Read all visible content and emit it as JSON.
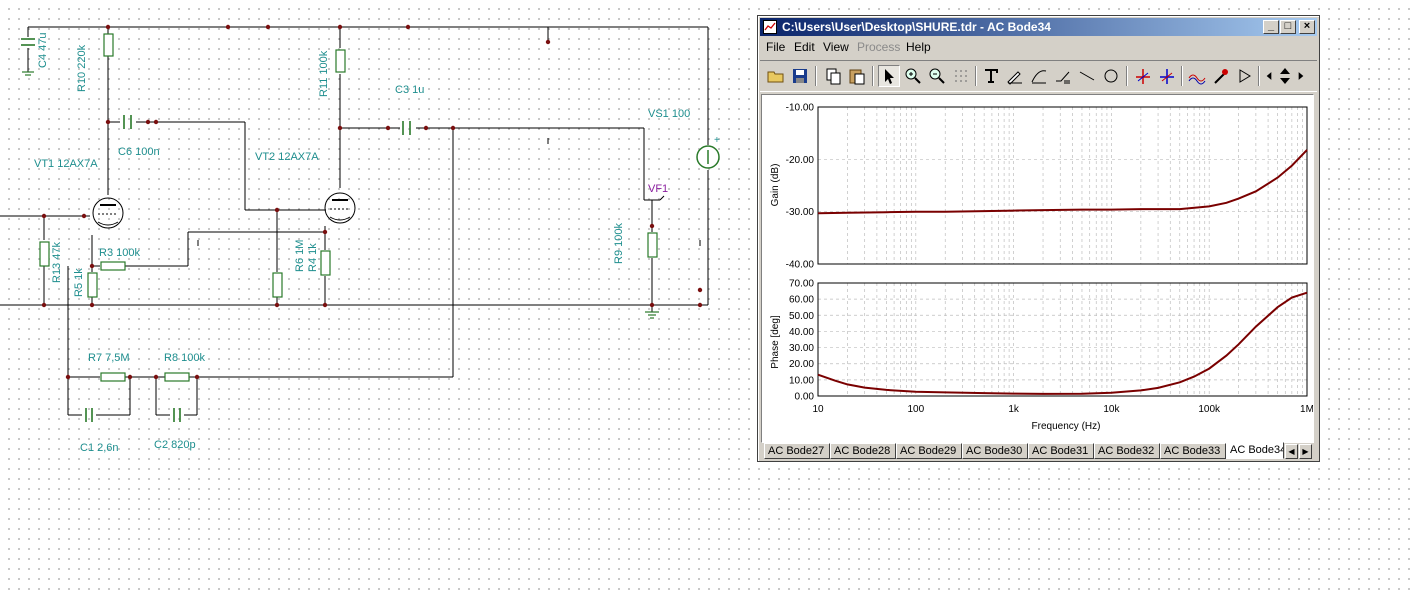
{
  "schematic": {
    "labels": {
      "c4": "C4 47u",
      "r10": "R10 220k",
      "vt1": "VT1 12AX7A",
      "c6": "C6 100n",
      "r13": "R13 47k",
      "r3": "R3 100k",
      "r5": "R5 1k",
      "vt2": "VT2 12AX7A",
      "r11": "R11 100k",
      "c3": "C3 1u",
      "r6": "R6 1M",
      "r4": "R4 1k",
      "vs1": "VS1 100",
      "vf1": "VF1",
      "r9": "R9 100k",
      "r7": "R7 7,5M",
      "r8": "R8 100k",
      "c1": "C1 2,6n",
      "c2": "C2 820p",
      "plus": "+"
    },
    "colors": {
      "wire": "#000000",
      "component": "#2a7a2a",
      "label": "#1e8e8e",
      "node": "#7a1010",
      "probe": "#8a1e9e"
    }
  },
  "window": {
    "title": "C:\\Users\\User\\Desktop\\SHURE.tdr - AC Bode34",
    "controls": {
      "minimize": "_",
      "maximize": "□",
      "close": "×"
    },
    "menu": [
      {
        "label": "File",
        "enabled": true
      },
      {
        "label": "Edit",
        "enabled": true
      },
      {
        "label": "View",
        "enabled": true
      },
      {
        "label": "Process",
        "enabled": false
      },
      {
        "label": "Help",
        "enabled": true
      }
    ],
    "toolbar": [
      "open-icon",
      "save-icon",
      "copy-icon",
      "paste-icon",
      "pointer-icon",
      "zoom-in-icon",
      "zoom-out-icon",
      "grid-icon",
      "text-icon",
      "pen-icon",
      "curve-icon",
      "slope-icon",
      "line-icon",
      "circle-icon",
      "cursor-a-icon",
      "cursor-b-icon",
      "peak-icon",
      "probe-icon",
      "arrow-icon",
      "left-icon",
      "updown-icon",
      "right-icon"
    ],
    "tabs": [
      "AC Bode27",
      "AC Bode28",
      "AC Bode29",
      "AC Bode30",
      "AC Bode31",
      "AC Bode32",
      "AC Bode33",
      "AC Bode34"
    ],
    "active_tab": "AC Bode34"
  },
  "chart_data": [
    {
      "type": "line",
      "title": "",
      "xlabel": "",
      "ylabel": "Gain (dB)",
      "xscale": "log",
      "xlim": [
        10,
        1000000
      ],
      "ylim": [
        -40,
        -10
      ],
      "yticks": [
        "-10.00",
        "-20.00",
        "-30.00",
        "-40.00"
      ],
      "grid": true,
      "color": "#7a0000",
      "series": [
        {
          "x": [
            10,
            20,
            50,
            100,
            200,
            500,
            1000,
            2000,
            5000,
            10000,
            20000,
            50000,
            100000,
            150000,
            200000,
            300000,
            500000,
            700000,
            1000000
          ],
          "y": [
            -30.3,
            -30.2,
            -30.1,
            -30.0,
            -30.0,
            -29.9,
            -29.8,
            -29.7,
            -29.6,
            -29.6,
            -29.5,
            -29.5,
            -29.0,
            -28.3,
            -27.5,
            -26.1,
            -23.5,
            -21.2,
            -18.2
          ]
        }
      ]
    },
    {
      "type": "line",
      "title": "",
      "xlabel": "Frequency (Hz)",
      "ylabel": "Phase [deg]",
      "xscale": "log",
      "xlim": [
        10,
        1000000
      ],
      "ylim": [
        0,
        70
      ],
      "xticks": [
        "10",
        "100",
        "1k",
        "10k",
        "100k",
        "1M"
      ],
      "yticks": [
        "70.00",
        "60.00",
        "50.00",
        "40.00",
        "30.00",
        "20.00",
        "10.00",
        "0.00"
      ],
      "grid": true,
      "color": "#7a0000",
      "series": [
        {
          "x": [
            10,
            15,
            20,
            30,
            50,
            100,
            200,
            500,
            1000,
            2000,
            5000,
            10000,
            20000,
            30000,
            50000,
            70000,
            100000,
            150000,
            200000,
            300000,
            500000,
            700000,
            1000000
          ],
          "y": [
            13.2,
            9.5,
            7.2,
            5.2,
            3.8,
            2.6,
            2.2,
            1.8,
            1.5,
            1.3,
            1.4,
            2.0,
            3.5,
            5.0,
            8.5,
            12,
            17,
            25,
            32,
            43,
            55,
            61,
            64
          ]
        }
      ]
    }
  ]
}
